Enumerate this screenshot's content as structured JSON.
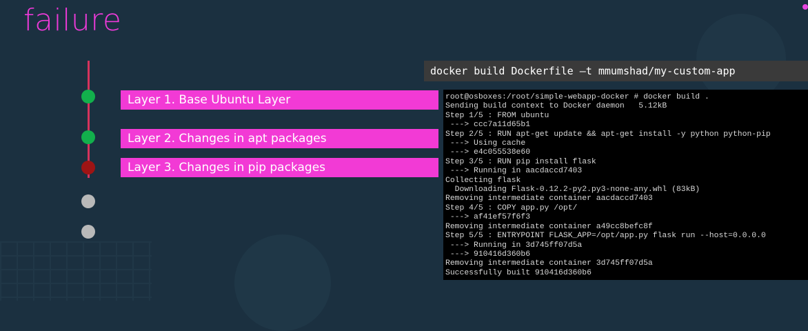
{
  "slide": {
    "title": "failure"
  },
  "layers": [
    {
      "label": "Layer 1. Base Ubuntu Layer",
      "status": "success"
    },
    {
      "label": "Layer 2. Changes in apt packages",
      "status": "success"
    },
    {
      "label": "Layer 3. Changes in pip packages",
      "status": "failed"
    },
    {
      "label": "",
      "status": "pending"
    },
    {
      "label": "",
      "status": "pending"
    }
  ],
  "command": "docker build Dockerfile –t mmumshad/my-custom-app",
  "terminal": {
    "lines": [
      "root@osboxes:/root/simple-webapp-docker # docker build .",
      "Sending build context to Docker daemon   5.12kB",
      "Step 1/5 : FROM ubuntu",
      " ---> ccc7a11d65b1",
      "Step 2/5 : RUN apt-get update && apt-get install -y python python-pip",
      " ---> Using cache",
      " ---> e4c055538e60",
      "Step 3/5 : RUN pip install flask",
      " ---> Running in aacdaccd7403",
      "Collecting flask",
      "  Downloading Flask-0.12.2-py2.py3-none-any.whl (83kB)",
      "Removing intermediate container aacdaccd7403",
      "Step 4/5 : COPY app.py /opt/",
      " ---> af41ef57f6f3",
      "Removing intermediate container a49cc8befc8f",
      "Step 5/5 : ENTRYPOINT FLASK_APP=/opt/app.py flask run --host=0.0.0.0",
      " ---> Running in 3d745ff07d5a",
      " ---> 910416d360b6",
      "Removing intermediate container 3d745ff07d5a",
      "Successfully built 910416d360b6"
    ]
  },
  "colors": {
    "accent": "#f23ad5",
    "success": "#12b04c",
    "failure": "#9e1414",
    "pending": "#b9b9b9",
    "background": "#1b3040"
  }
}
